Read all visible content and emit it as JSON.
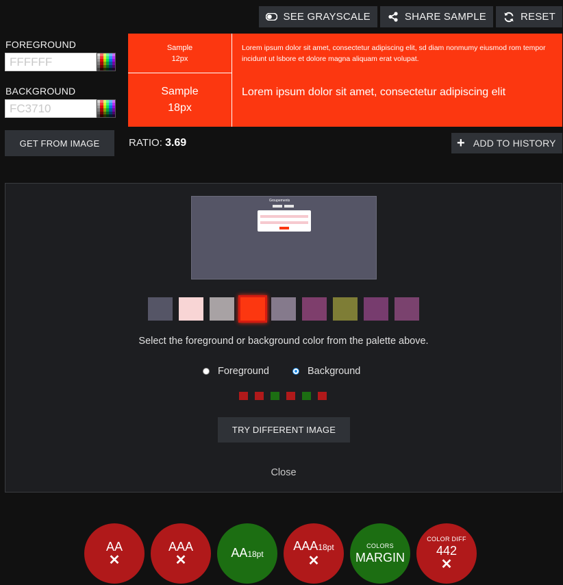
{
  "toolbar": {
    "grayscale_label": "SEE GRAYSCALE",
    "share_label": "SHARE SAMPLE",
    "reset_label": "RESET",
    "grayscale_icon": "toggle-icon",
    "share_icon": "share-icon",
    "reset_icon": "refresh-icon"
  },
  "foreground": {
    "label": "FOREGROUND",
    "value": "FFFFFF",
    "color": "#FFFFFF"
  },
  "background": {
    "label": "BACKGROUND",
    "value": "FC3710",
    "color": "#FC3710"
  },
  "get_from_image_label": "GET FROM IMAGE",
  "sample": {
    "small_title": "Sample",
    "small_size": "12px",
    "small_text": "Lorem ipsum dolor sit amet, consectetur adipiscing elit, sd diam nonmumy eiusmod rom tempor incidunt ut lsbore et dolore magna aliquam erat volupat.",
    "large_title": "Sample",
    "large_size": "18px",
    "large_text": "Lorem ipsum dolor sit amet, consectetur adipiscing elit"
  },
  "ratio": {
    "label": "RATIO:",
    "value": "3.69"
  },
  "history_label": "ADD TO HISTORY",
  "image_panel": {
    "preview_brand": "Groupements",
    "palette": [
      "#555566",
      "#F8D5D5",
      "#A8A2A4",
      "#FC3710",
      "#857A8C",
      "#7E3E6C",
      "#7E7D36",
      "#773C6E",
      "#7A426E"
    ],
    "selected_index": 3,
    "instruction": "Select the foreground or background color from the palette above.",
    "radio_foreground": "Foreground",
    "radio_background": "Background",
    "selected_radio": "Background",
    "indicator_colors": [
      "#b0191a",
      "#b0191a",
      "#1c6e12",
      "#b0191a",
      "#1c6e12",
      "#b0191a"
    ],
    "try_label": "TRY DIFFERENT IMAGE",
    "close_label": "Close"
  },
  "badges": [
    {
      "title": "",
      "main": "AA",
      "suffix": "",
      "status": "✕",
      "pass": false
    },
    {
      "title": "",
      "main": "AAA",
      "suffix": "",
      "status": "✕",
      "pass": false
    },
    {
      "title": "",
      "main": "AA",
      "suffix": "18pt",
      "status": "",
      "pass": true
    },
    {
      "title": "",
      "main": "AAA",
      "suffix": "18pt",
      "status": "✕",
      "pass": false
    },
    {
      "title": "COLORS",
      "main": "MARGIN",
      "suffix": "",
      "status": "",
      "pass": true
    },
    {
      "title": "COLOR DIFF",
      "main": "442",
      "suffix": "",
      "status": "✕",
      "pass": false
    }
  ]
}
